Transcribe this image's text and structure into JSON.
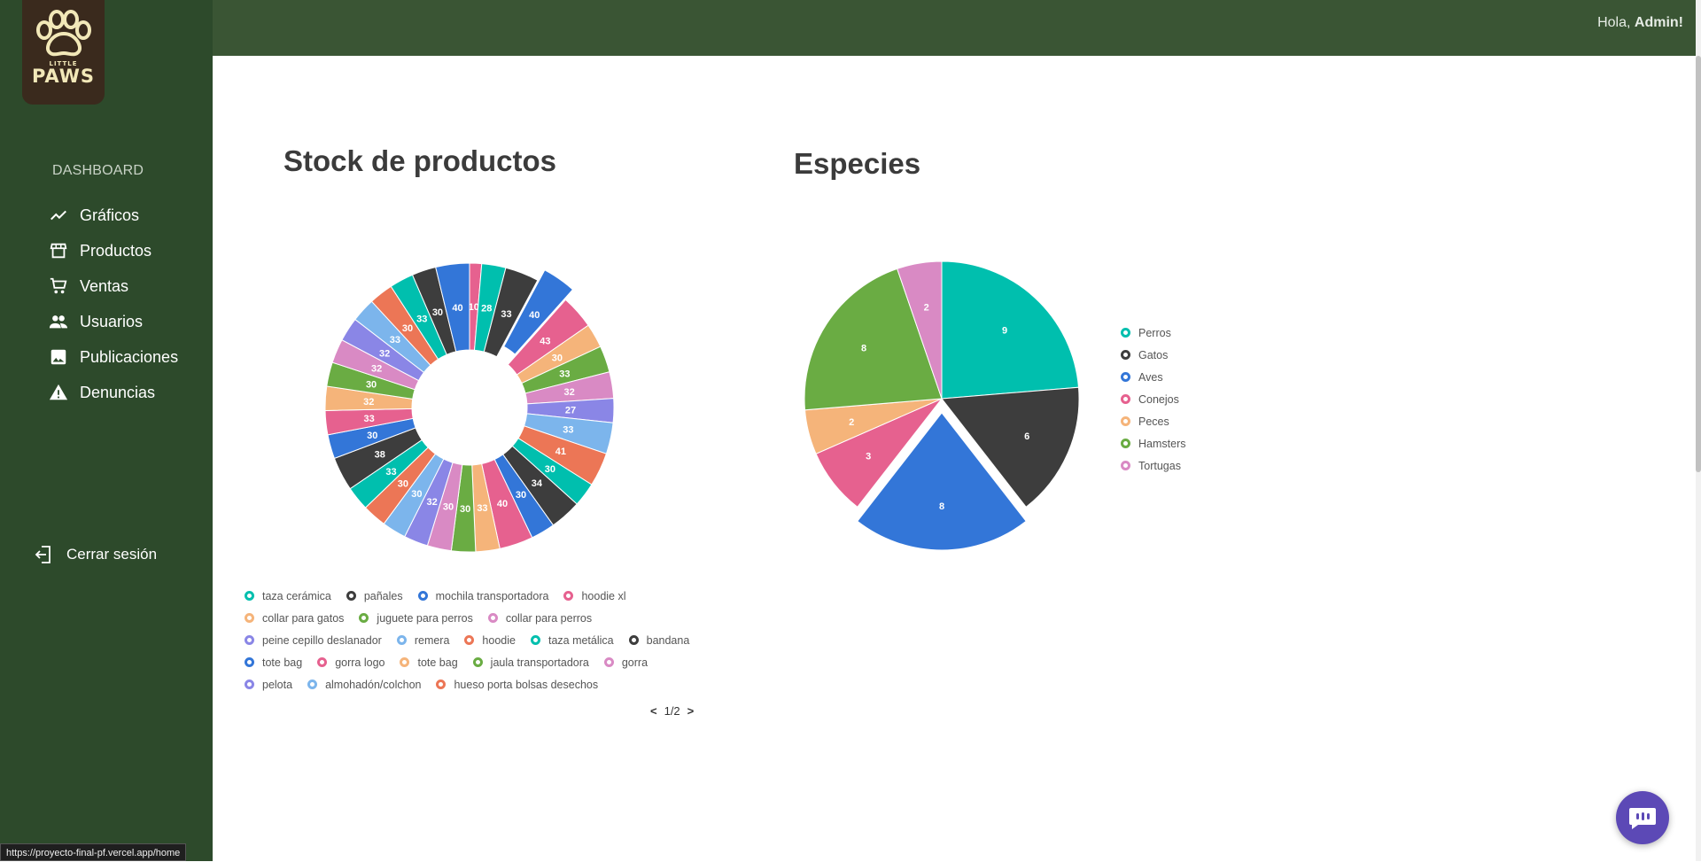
{
  "logo": {
    "small": "LITTLE",
    "big": "PAWS"
  },
  "header": {
    "greeting_prefix": "Hola, ",
    "greeting_user": "Admin!"
  },
  "sidebar": {
    "section_title": "DASHBOARD",
    "items": [
      {
        "label": "Gráficos",
        "icon": "trending-up-icon"
      },
      {
        "label": "Productos",
        "icon": "store-icon"
      },
      {
        "label": "Ventas",
        "icon": "shopping-cart-icon"
      },
      {
        "label": "Usuarios",
        "icon": "people-icon"
      },
      {
        "label": "Publicaciones",
        "icon": "image-icon"
      },
      {
        "label": "Denuncias",
        "icon": "warning-icon"
      }
    ],
    "logout_label": "Cerrar sesión"
  },
  "pager": {
    "prev": "<",
    "label": "1/2",
    "next": ">"
  },
  "status_url": "https://proyecto-final-pf.vercel.app/home",
  "colors": {
    "sidebar": "#2d4a2b",
    "topbar": "#3a5534",
    "chat": "#5c49b6"
  },
  "chart_data": [
    {
      "type": "pie",
      "variant": "donut",
      "title": "Stock de productos",
      "legend_position": "bottom",
      "slice_labels": [
        "10",
        "28",
        "33",
        "40",
        "43",
        "30",
        "33",
        "32",
        "27",
        "33",
        "41",
        "30",
        "34",
        "30",
        "40",
        "33",
        "30",
        "30",
        "32",
        "30",
        "30",
        "33",
        "38",
        "30",
        "33",
        "32",
        "30",
        "32",
        "32",
        "33",
        "30",
        "33",
        "30",
        "40"
      ],
      "values": [
        5,
        10,
        14,
        14,
        14,
        10,
        11,
        11,
        10,
        13,
        14,
        10,
        13,
        10,
        14,
        10,
        10,
        10,
        10,
        10,
        10,
        10,
        14,
        10,
        10,
        10,
        10,
        10,
        10,
        10,
        10,
        10,
        10,
        14
      ],
      "colors": [
        "#e6618f",
        "#00bfae",
        "#3d3d3d",
        "#3376d8",
        "#e6618f",
        "#f5b47a",
        "#6aac43",
        "#d98ac4",
        "#8a86e6",
        "#7cb5ec",
        "#ec7656",
        "#00bfae",
        "#3d3d3d",
        "#3376d8",
        "#e6618f",
        "#f5b47a",
        "#6aac43",
        "#d98ac4",
        "#8a86e6",
        "#7cb5ec",
        "#ec7656",
        "#00bfae",
        "#3d3d3d",
        "#3376d8",
        "#e6618f",
        "#f5b47a",
        "#6aac43",
        "#d98ac4",
        "#8a86e6",
        "#7cb5ec",
        "#ec7656",
        "#00bfae",
        "#3d3d3d",
        "#3376d8"
      ],
      "exploded_index": 3,
      "legend": [
        {
          "label": "taza cerámica",
          "color": "#00bfae"
        },
        {
          "label": "pañales",
          "color": "#3d3d3d"
        },
        {
          "label": "mochila transportadora",
          "color": "#3376d8"
        },
        {
          "label": "hoodie xl",
          "color": "#e6618f"
        },
        {
          "label": "collar para gatos",
          "color": "#f5b47a"
        },
        {
          "label": "juguete para perros",
          "color": "#6aac43"
        },
        {
          "label": "collar para perros",
          "color": "#d98ac4"
        },
        {
          "label": "peine cepillo deslanador",
          "color": "#8a86e6"
        },
        {
          "label": "remera",
          "color": "#7cb5ec"
        },
        {
          "label": "hoodie",
          "color": "#ec7656"
        },
        {
          "label": "taza metálica",
          "color": "#00bfae"
        },
        {
          "label": "bandana",
          "color": "#3d3d3d"
        },
        {
          "label": "tote bag",
          "color": "#3376d8"
        },
        {
          "label": "gorra logo",
          "color": "#e6618f"
        },
        {
          "label": "tote bag",
          "color": "#f5b47a"
        },
        {
          "label": "jaula transportadora",
          "color": "#6aac43"
        },
        {
          "label": "gorra",
          "color": "#d98ac4"
        },
        {
          "label": "pelota",
          "color": "#8a86e6"
        },
        {
          "label": "almohadón/colchon",
          "color": "#7cb5ec"
        },
        {
          "label": "hueso porta bolsas desechos",
          "color": "#ec7656"
        }
      ]
    },
    {
      "type": "pie",
      "title": "Especies",
      "legend_position": "right",
      "categories": [
        "Perros",
        "Gatos",
        "Aves",
        "Conejos",
        "Peces",
        "Hamsters",
        "Tortugas"
      ],
      "values": [
        9,
        6,
        8,
        3,
        2,
        8,
        2
      ],
      "colors": [
        "#00bfae",
        "#3d3d3d",
        "#3376d8",
        "#e6618f",
        "#f5b47a",
        "#6aac43",
        "#d98ac4"
      ],
      "exploded_index": 2
    }
  ]
}
